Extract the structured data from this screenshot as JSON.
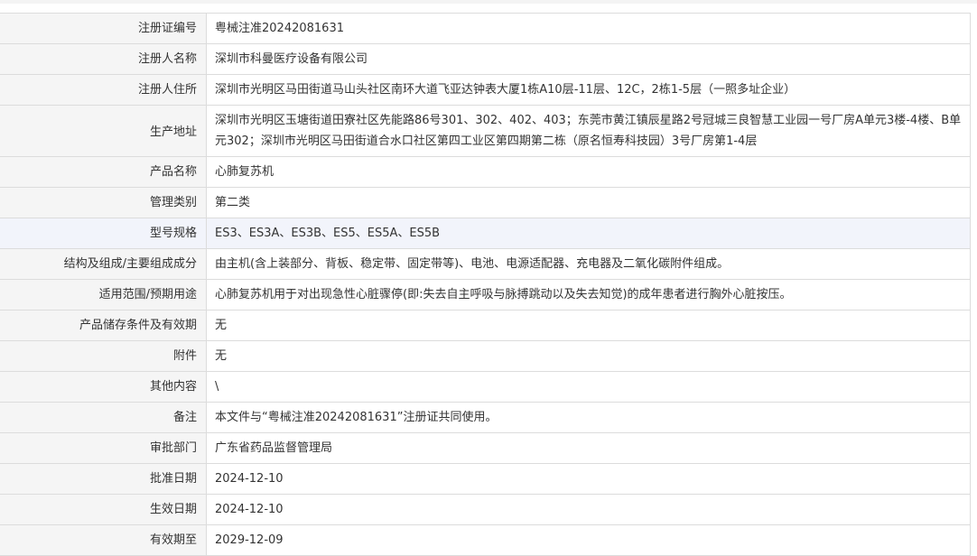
{
  "rows": [
    {
      "label": "注册证编号",
      "value": "粤械注准20242081631"
    },
    {
      "label": "注册人名称",
      "value": "深圳市科曼医疗设备有限公司"
    },
    {
      "label": "注册人住所",
      "value": "深圳市光明区马田街道马山头社区南环大道飞亚达钟表大厦1栋A10层-11层、12C，2栋1-5层（一照多址企业）"
    },
    {
      "label": "生产地址",
      "value": "深圳市光明区玉塘街道田寮社区先能路86号301、302、402、403；东莞市黄江镇辰星路2号冠城三良智慧工业园一号厂房A单元3楼-4楼、B单元302；深圳市光明区马田街道合水口社区第四工业区第四期第二栋（原名恒寿科技园）3号厂房第1-4层"
    },
    {
      "label": "产品名称",
      "value": "心肺复苏机"
    },
    {
      "label": "管理类别",
      "value": "第二类"
    },
    {
      "label": "型号规格",
      "value": "ES3、ES3A、ES3B、ES5、ES5A、ES5B"
    },
    {
      "label": "结构及组成/主要组成成分",
      "value": "由主机(含上装部分、背板、稳定带、固定带等)、电池、电源适配器、充电器及二氧化碳附件组成。"
    },
    {
      "label": "适用范围/预期用途",
      "value": "心肺复苏机用于对出现急性心脏骤停(即:失去自主呼吸与脉搏跳动以及失去知觉)的成年患者进行胸外心脏按压。"
    },
    {
      "label": "产品储存条件及有效期",
      "value": "无"
    },
    {
      "label": "附件",
      "value": "无"
    },
    {
      "label": "其他内容",
      "value": "\\"
    },
    {
      "label": "备注",
      "value": "本文件与“粤械注准20242081631”注册证共同使用。"
    },
    {
      "label": "审批部门",
      "value": "广东省药品监督管理局"
    },
    {
      "label": "批准日期",
      "value": "2024-12-10"
    },
    {
      "label": "生效日期",
      "value": "2024-12-10"
    },
    {
      "label": "有效期至",
      "value": "2029-12-09"
    }
  ]
}
